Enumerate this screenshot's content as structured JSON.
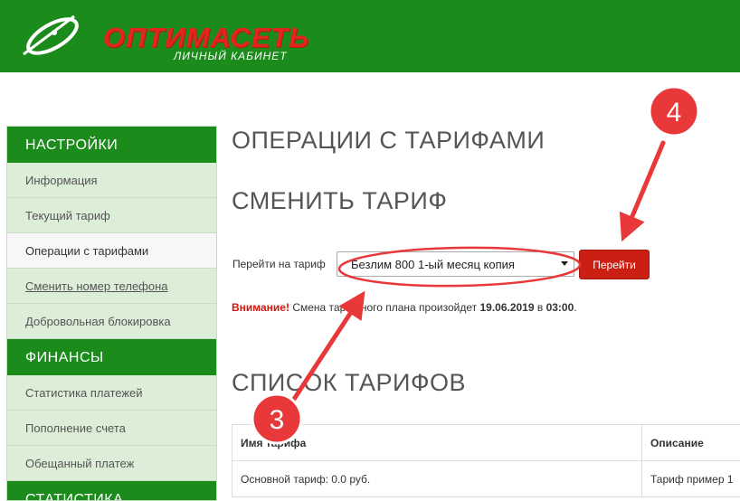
{
  "header": {
    "brand": "ОПТИМАСЕТЬ",
    "subtitle": "ЛИЧНЫЙ КАБИНЕТ",
    "logo_icon": "orbit-swoosh-icon",
    "bg_color": "#1b8b1b",
    "brand_color": "#e3251f"
  },
  "sidebar": {
    "sections": [
      {
        "title": "НАСТРОЙКИ",
        "items": [
          {
            "label": "Информация"
          },
          {
            "label": "Текущий тариф"
          },
          {
            "label": "Операции с тарифами",
            "active": true
          },
          {
            "label": "Сменить номер телефона"
          },
          {
            "label": "Добровольная блокировка"
          }
        ]
      },
      {
        "title": "ФИНАНСЫ",
        "items": [
          {
            "label": "Статистика платежей"
          },
          {
            "label": "Пополнение счета"
          },
          {
            "label": "Обещанный платеж"
          }
        ]
      },
      {
        "title": "СТАТИСТИКА",
        "items": []
      }
    ]
  },
  "main": {
    "page_title": "ОПЕРАЦИИ С ТАРИФАМИ",
    "section_change": "СМЕНИТЬ ТАРИФ",
    "form": {
      "label": "Перейти на тариф",
      "selected": "Безлим 800 1-ый месяц копия",
      "submit_label": "Перейти"
    },
    "notice": {
      "warning": "Внимание!",
      "text_before": " Смена тарифного плана произойдет ",
      "date": "19.06.2019",
      "text_mid": " в ",
      "time": "03:00",
      "text_after": "."
    },
    "section_list": "СПИСОК ТАРИФОВ",
    "table": {
      "columns": [
        "Имя тарифа",
        "Описание"
      ],
      "rows": [
        [
          "Основной тариф: 0.0 руб.",
          "Тариф пример 1"
        ]
      ]
    }
  },
  "annotations": {
    "badge_3": "3",
    "badge_4": "4",
    "color": "#e8383a"
  }
}
